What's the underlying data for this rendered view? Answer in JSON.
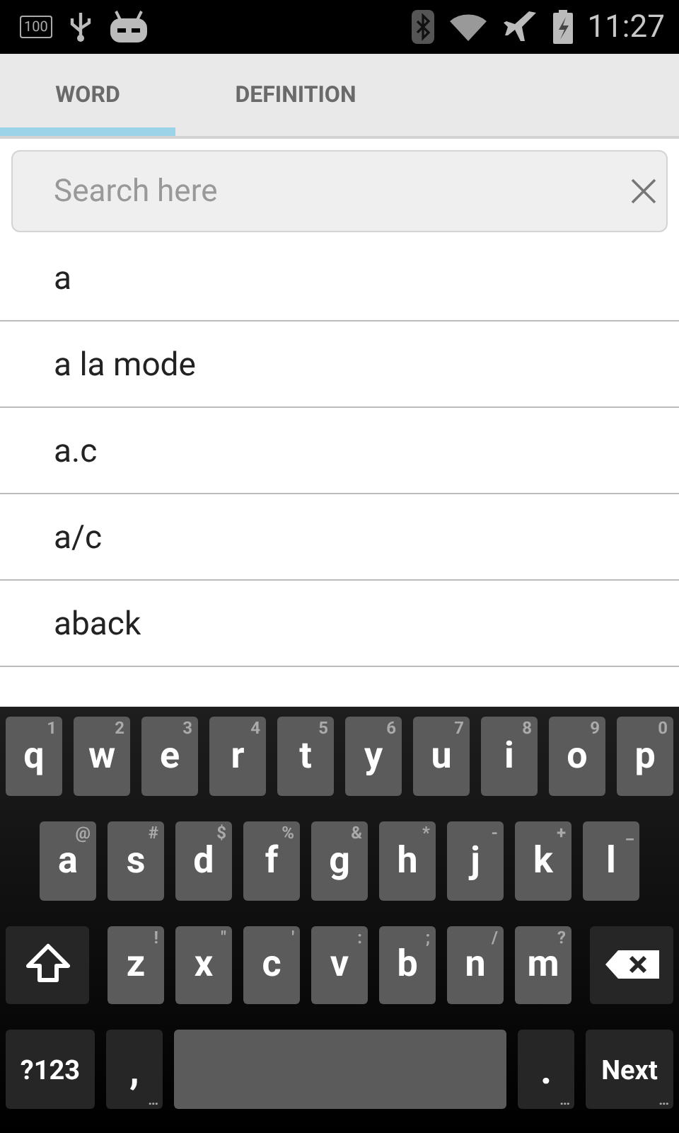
{
  "status_bar": {
    "battery_level_text": "100",
    "time": "11:27"
  },
  "tabs": [
    {
      "label": "WORD",
      "selected": true
    },
    {
      "label": "DEFINITION",
      "selected": false
    }
  ],
  "search": {
    "placeholder": "Search here"
  },
  "words": [
    "a",
    "a la mode",
    "a.c",
    "a/c",
    "aback"
  ],
  "keyboard": {
    "rows": [
      [
        {
          "kind": "letter",
          "label": "q",
          "hint": "1"
        },
        {
          "kind": "letter",
          "label": "w",
          "hint": "2"
        },
        {
          "kind": "letter",
          "label": "e",
          "hint": "3"
        },
        {
          "kind": "letter",
          "label": "r",
          "hint": "4"
        },
        {
          "kind": "letter",
          "label": "t",
          "hint": "5"
        },
        {
          "kind": "letter",
          "label": "y",
          "hint": "6"
        },
        {
          "kind": "letter",
          "label": "u",
          "hint": "7"
        },
        {
          "kind": "letter",
          "label": "i",
          "hint": "8"
        },
        {
          "kind": "letter",
          "label": "o",
          "hint": "9"
        },
        {
          "kind": "letter",
          "label": "p",
          "hint": "0"
        }
      ],
      [
        {
          "kind": "letter",
          "label": "a",
          "hint": "@"
        },
        {
          "kind": "letter",
          "label": "s",
          "hint": "#"
        },
        {
          "kind": "letter",
          "label": "d",
          "hint": "$"
        },
        {
          "kind": "letter",
          "label": "f",
          "hint": "%"
        },
        {
          "kind": "letter",
          "label": "g",
          "hint": "&"
        },
        {
          "kind": "letter",
          "label": "h",
          "hint": "*"
        },
        {
          "kind": "letter",
          "label": "j",
          "hint": "-"
        },
        {
          "kind": "letter",
          "label": "k",
          "hint": "+"
        },
        {
          "kind": "letter",
          "label": "l",
          "hint": "_"
        }
      ],
      [
        {
          "kind": "shift"
        },
        {
          "kind": "letter",
          "label": "z",
          "hint": "!"
        },
        {
          "kind": "letter",
          "label": "x",
          "hint": "\""
        },
        {
          "kind": "letter",
          "label": "c",
          "hint": "'"
        },
        {
          "kind": "letter",
          "label": "v",
          "hint": ":"
        },
        {
          "kind": "letter",
          "label": "b",
          "hint": ";"
        },
        {
          "kind": "letter",
          "label": "n",
          "hint": "/"
        },
        {
          "kind": "letter",
          "label": "m",
          "hint": "?"
        },
        {
          "kind": "backspace"
        }
      ]
    ],
    "bottom_row": [
      {
        "kind": "mode",
        "label": "?123"
      },
      {
        "kind": "punct",
        "label": ",",
        "hint": "…"
      },
      {
        "kind": "space"
      },
      {
        "kind": "punct",
        "label": ".",
        "hint": "…"
      },
      {
        "kind": "action",
        "label": "Next",
        "hint": "…"
      }
    ]
  }
}
